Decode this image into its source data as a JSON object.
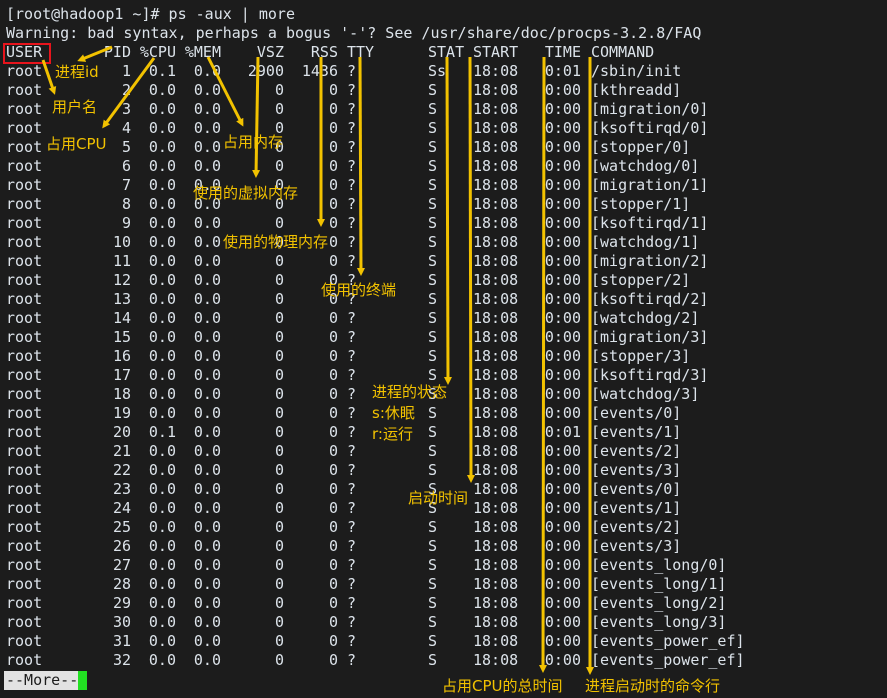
{
  "terminal": {
    "prompt_line": "[root@hadoop1 ~]# ps -aux | more",
    "warning_line": "Warning: bad syntax, perhaps a bogus '-'? See /usr/share/doc/procps-3.2.8/FAQ",
    "headers": [
      "USER",
      "PID",
      "%CPU",
      "%MEM",
      "VSZ",
      "RSS",
      "TTY",
      "STAT",
      "START",
      "TIME",
      "COMMAND"
    ],
    "rows": [
      [
        "root",
        "1",
        "0.1",
        "0.0",
        "2900",
        "1436",
        "?",
        "Ss",
        "18:08",
        "0:01",
        "/sbin/init"
      ],
      [
        "root",
        "2",
        "0.0",
        "0.0",
        "0",
        "0",
        "?",
        "S",
        "18:08",
        "0:00",
        "[kthreadd]"
      ],
      [
        "root",
        "3",
        "0.0",
        "0.0",
        "0",
        "0",
        "?",
        "S",
        "18:08",
        "0:00",
        "[migration/0]"
      ],
      [
        "root",
        "4",
        "0.0",
        "0.0",
        "0",
        "0",
        "?",
        "S",
        "18:08",
        "0:00",
        "[ksoftirqd/0]"
      ],
      [
        "root",
        "5",
        "0.0",
        "0.0",
        "0",
        "0",
        "?",
        "S",
        "18:08",
        "0:00",
        "[stopper/0]"
      ],
      [
        "root",
        "6",
        "0.0",
        "0.0",
        "0",
        "0",
        "?",
        "S",
        "18:08",
        "0:00",
        "[watchdog/0]"
      ],
      [
        "root",
        "7",
        "0.0",
        "0.0",
        "0",
        "0",
        "?",
        "S",
        "18:08",
        "0:00",
        "[migration/1]"
      ],
      [
        "root",
        "8",
        "0.0",
        "0.0",
        "0",
        "0",
        "?",
        "S",
        "18:08",
        "0:00",
        "[stopper/1]"
      ],
      [
        "root",
        "9",
        "0.0",
        "0.0",
        "0",
        "0",
        "?",
        "S",
        "18:08",
        "0:00",
        "[ksoftirqd/1]"
      ],
      [
        "root",
        "10",
        "0.0",
        "0.0",
        "0",
        "0",
        "?",
        "S",
        "18:08",
        "0:00",
        "[watchdog/1]"
      ],
      [
        "root",
        "11",
        "0.0",
        "0.0",
        "0",
        "0",
        "?",
        "S",
        "18:08",
        "0:00",
        "[migration/2]"
      ],
      [
        "root",
        "12",
        "0.0",
        "0.0",
        "0",
        "0",
        "?",
        "S",
        "18:08",
        "0:00",
        "[stopper/2]"
      ],
      [
        "root",
        "13",
        "0.0",
        "0.0",
        "0",
        "0",
        "?",
        "S",
        "18:08",
        "0:00",
        "[ksoftirqd/2]"
      ],
      [
        "root",
        "14",
        "0.0",
        "0.0",
        "0",
        "0",
        "?",
        "S",
        "18:08",
        "0:00",
        "[watchdog/2]"
      ],
      [
        "root",
        "15",
        "0.0",
        "0.0",
        "0",
        "0",
        "?",
        "S",
        "18:08",
        "0:00",
        "[migration/3]"
      ],
      [
        "root",
        "16",
        "0.0",
        "0.0",
        "0",
        "0",
        "?",
        "S",
        "18:08",
        "0:00",
        "[stopper/3]"
      ],
      [
        "root",
        "17",
        "0.0",
        "0.0",
        "0",
        "0",
        "?",
        "S",
        "18:08",
        "0:00",
        "[ksoftirqd/3]"
      ],
      [
        "root",
        "18",
        "0.0",
        "0.0",
        "0",
        "0",
        "?",
        "S",
        "18:08",
        "0:00",
        "[watchdog/3]"
      ],
      [
        "root",
        "19",
        "0.0",
        "0.0",
        "0",
        "0",
        "?",
        "S",
        "18:08",
        "0:00",
        "[events/0]"
      ],
      [
        "root",
        "20",
        "0.1",
        "0.0",
        "0",
        "0",
        "?",
        "S",
        "18:08",
        "0:01",
        "[events/1]"
      ],
      [
        "root",
        "21",
        "0.0",
        "0.0",
        "0",
        "0",
        "?",
        "S",
        "18:08",
        "0:00",
        "[events/2]"
      ],
      [
        "root",
        "22",
        "0.0",
        "0.0",
        "0",
        "0",
        "?",
        "S",
        "18:08",
        "0:00",
        "[events/3]"
      ],
      [
        "root",
        "23",
        "0.0",
        "0.0",
        "0",
        "0",
        "?",
        "S",
        "18:08",
        "0:00",
        "[events/0]"
      ],
      [
        "root",
        "24",
        "0.0",
        "0.0",
        "0",
        "0",
        "?",
        "S",
        "18:08",
        "0:00",
        "[events/1]"
      ],
      [
        "root",
        "25",
        "0.0",
        "0.0",
        "0",
        "0",
        "?",
        "S",
        "18:08",
        "0:00",
        "[events/2]"
      ],
      [
        "root",
        "26",
        "0.0",
        "0.0",
        "0",
        "0",
        "?",
        "S",
        "18:08",
        "0:00",
        "[events/3]"
      ],
      [
        "root",
        "27",
        "0.0",
        "0.0",
        "0",
        "0",
        "?",
        "S",
        "18:08",
        "0:00",
        "[events_long/0]"
      ],
      [
        "root",
        "28",
        "0.0",
        "0.0",
        "0",
        "0",
        "?",
        "S",
        "18:08",
        "0:00",
        "[events_long/1]"
      ],
      [
        "root",
        "29",
        "0.0",
        "0.0",
        "0",
        "0",
        "?",
        "S",
        "18:08",
        "0:00",
        "[events_long/2]"
      ],
      [
        "root",
        "30",
        "0.0",
        "0.0",
        "0",
        "0",
        "?",
        "S",
        "18:08",
        "0:00",
        "[events_long/3]"
      ],
      [
        "root",
        "31",
        "0.0",
        "0.0",
        "0",
        "0",
        "?",
        "S",
        "18:08",
        "0:00",
        "[events_power_ef]"
      ],
      [
        "root",
        "32",
        "0.0",
        "0.0",
        "0",
        "0",
        "?",
        "S",
        "18:08",
        "0:00",
        "[events_power_ef]"
      ]
    ],
    "more_prompt": "--More--"
  },
  "annotations": {
    "pid": "进程id",
    "user": "用户名",
    "cpu": "占用CPU",
    "mem": "占用内存",
    "vsz": "使用的虚拟内存",
    "rss": "使用的物理内存",
    "tty": "使用的终端",
    "stat": "进程的状态",
    "stat_s": "s:休眠",
    "stat_r": "r:运行",
    "start": "启动时间",
    "time": "占用CPU的总时间",
    "command": "进程启动时的命令行"
  },
  "colors": {
    "annotation": "#f2c200",
    "highlight_box": "#e8141c",
    "cursor": "#22e022"
  }
}
